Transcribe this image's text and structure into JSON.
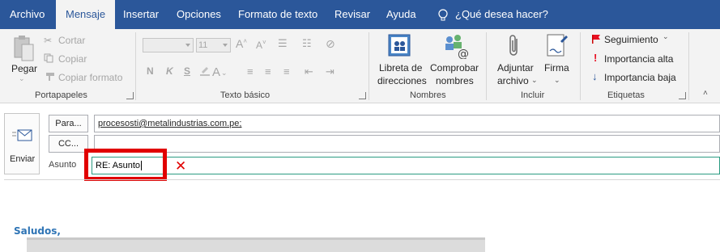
{
  "tabs": [
    {
      "label": "Archivo",
      "active": false
    },
    {
      "label": "Mensaje",
      "active": true
    },
    {
      "label": "Insertar",
      "active": false
    },
    {
      "label": "Opciones",
      "active": false
    },
    {
      "label": "Formato de texto",
      "active": false
    },
    {
      "label": "Revisar",
      "active": false
    },
    {
      "label": "Ayuda",
      "active": false
    }
  ],
  "tell_me": "¿Qué desea hacer?",
  "portapapeles": {
    "pegar": "Pegar",
    "cortar": "Cortar",
    "copiar": "Copiar",
    "copiar_formato": "Copiar formato",
    "label": "Portapapeles"
  },
  "texto_basico": {
    "font_size": "11",
    "bold": "N",
    "italic": "K",
    "underline": "S",
    "label": "Texto básico"
  },
  "nombres": {
    "libreta_line1": "Libreta de",
    "libreta_line2": "direcciones",
    "comprobar_line1": "Comprobar",
    "comprobar_line2": "nombres",
    "label": "Nombres"
  },
  "incluir": {
    "adjuntar_line1": "Adjuntar",
    "adjuntar_line2": "archivo",
    "firma": "Firma",
    "label": "Incluir"
  },
  "etiquetas": {
    "seguimiento": "Seguimiento",
    "importancia_alta": "Importancia alta",
    "importancia_baja": "Importancia baja",
    "label": "Etiquetas"
  },
  "compose": {
    "enviar": "Enviar",
    "para_btn": "Para...",
    "cc_btn": "CC...",
    "asunto_label": "Asunto",
    "to_value": "procesosti@metalindustrias.com.pe;",
    "cc_value": "",
    "subject_value": "RE: Asunto",
    "x_mark": "✕"
  },
  "body": {
    "greeting": "Saludos,"
  },
  "colors": {
    "tab_bar": "#2b579a",
    "ribbon_bg": "#f3f3f3",
    "highlight": "#e10000",
    "greeting_text": "#2e74b5"
  }
}
